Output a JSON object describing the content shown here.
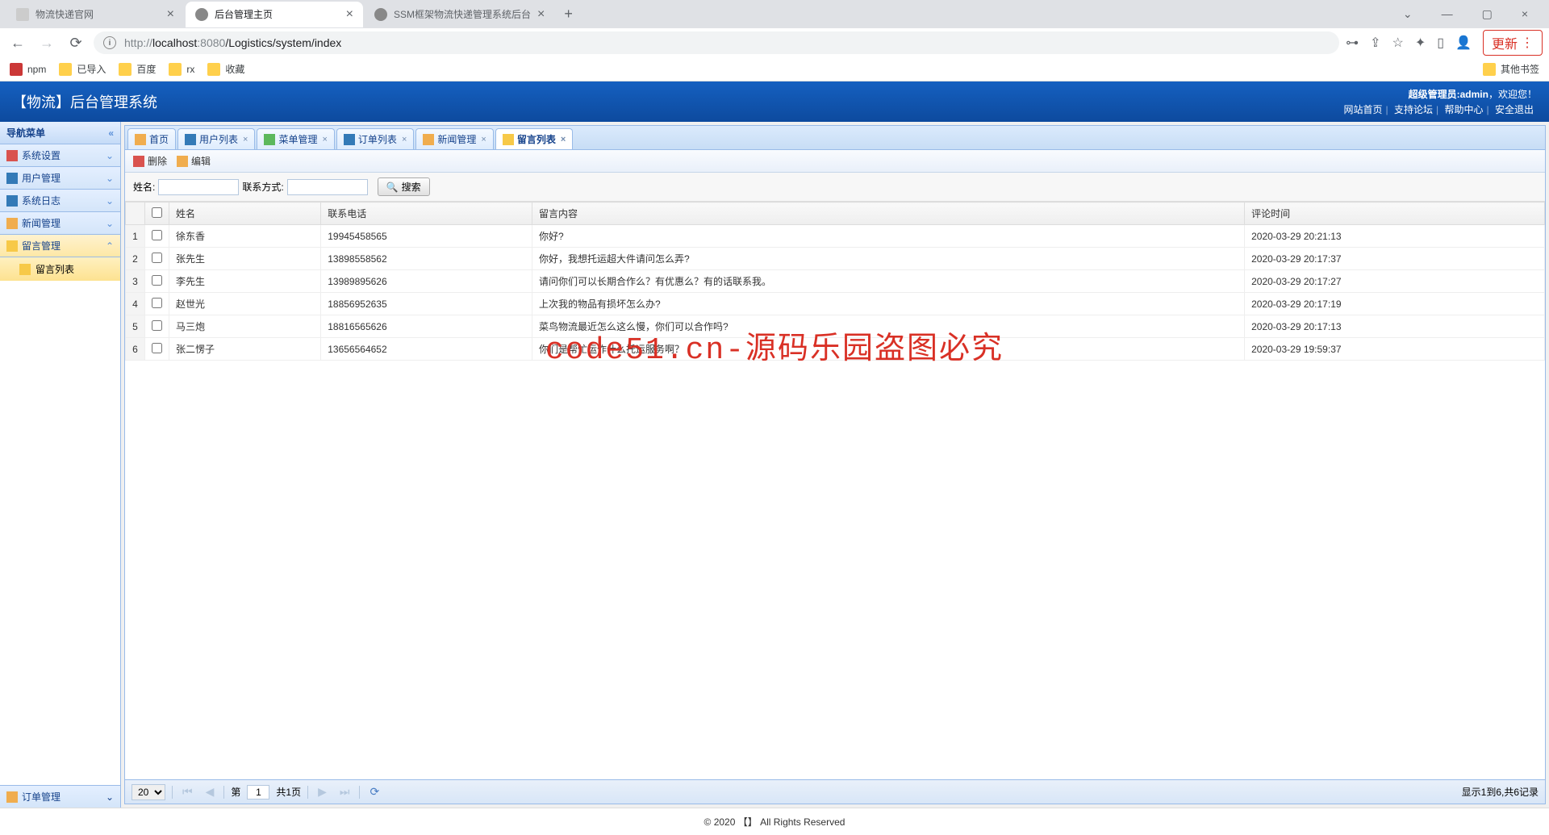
{
  "browser": {
    "tabs": [
      {
        "title": "物流快递官网",
        "active": false
      },
      {
        "title": "后台管理主页",
        "active": true
      },
      {
        "title": "SSM框架物流快递管理系统后台",
        "active": false
      }
    ],
    "url_prefix": "http://",
    "url_host": "localhost",
    "url_port": ":8080",
    "url_path": "/Logistics/system/index",
    "update_label": "更新",
    "bookmarks": [
      "npm",
      "已导入",
      "百度",
      "rx",
      "收藏"
    ],
    "other_bookmarks": "其他书签"
  },
  "header": {
    "title": "【物流】后台管理系统",
    "admin_label": "超级管理员:admin",
    "welcome": "，欢迎您！",
    "links": [
      "网站首页",
      "支持论坛",
      "帮助中心",
      "安全退出"
    ]
  },
  "sidebar": {
    "title": "导航菜单",
    "items": [
      {
        "label": "系统设置",
        "expanded": false
      },
      {
        "label": "用户管理",
        "expanded": false
      },
      {
        "label": "系统日志",
        "expanded": false
      },
      {
        "label": "新闻管理",
        "expanded": false
      },
      {
        "label": "留言管理",
        "expanded": true,
        "children": [
          {
            "label": "留言列表",
            "active": true
          }
        ]
      }
    ],
    "bottom": "订单管理"
  },
  "tabs": [
    {
      "label": "首页",
      "closable": false
    },
    {
      "label": "用户列表",
      "closable": true
    },
    {
      "label": "菜单管理",
      "closable": true
    },
    {
      "label": "订单列表",
      "closable": true
    },
    {
      "label": "新闻管理",
      "closable": true
    },
    {
      "label": "留言列表",
      "closable": true,
      "active": true
    }
  ],
  "toolbar": {
    "delete": "删除",
    "edit": "编辑"
  },
  "search": {
    "name_label": "姓名:",
    "contact_label": "联系方式:",
    "button": "搜索"
  },
  "table": {
    "headers": [
      "姓名",
      "联系电话",
      "留言内容",
      "评论时间"
    ],
    "rows": [
      {
        "n": "1",
        "name": "徐东香",
        "phone": "19945458565",
        "content": "你好?",
        "time": "2020-03-29 20:21:13"
      },
      {
        "n": "2",
        "name": "张先生",
        "phone": "13898558562",
        "content": "你好，我想托运超大件请问怎么弄?",
        "time": "2020-03-29 20:17:37"
      },
      {
        "n": "3",
        "name": "李先生",
        "phone": "13989895626",
        "content": "请问你们可以长期合作么？有优惠么？有的话联系我。",
        "time": "2020-03-29 20:17:27"
      },
      {
        "n": "4",
        "name": "赵世光",
        "phone": "18856952635",
        "content": "上次我的物品有损坏怎么办?",
        "time": "2020-03-29 20:17:19"
      },
      {
        "n": "5",
        "name": "马三炮",
        "phone": "18816565626",
        "content": "菜鸟物流最近怎么这么慢，你们可以合作吗?",
        "time": "2020-03-29 20:17:13"
      },
      {
        "n": "6",
        "name": "张二愣子",
        "phone": "13656564652",
        "content": "你们是帮忙运作什么托运服务啊？",
        "time": "2020-03-29 19:59:37"
      }
    ]
  },
  "pagination": {
    "page_size": "20",
    "page_label_pre": "第",
    "page": "1",
    "total_pages": "共1页",
    "info": "显示1到6,共6记录"
  },
  "footer": "© 2020 【】 All Rights Reserved",
  "watermark": "code51.cn-源码乐园盗图必究"
}
